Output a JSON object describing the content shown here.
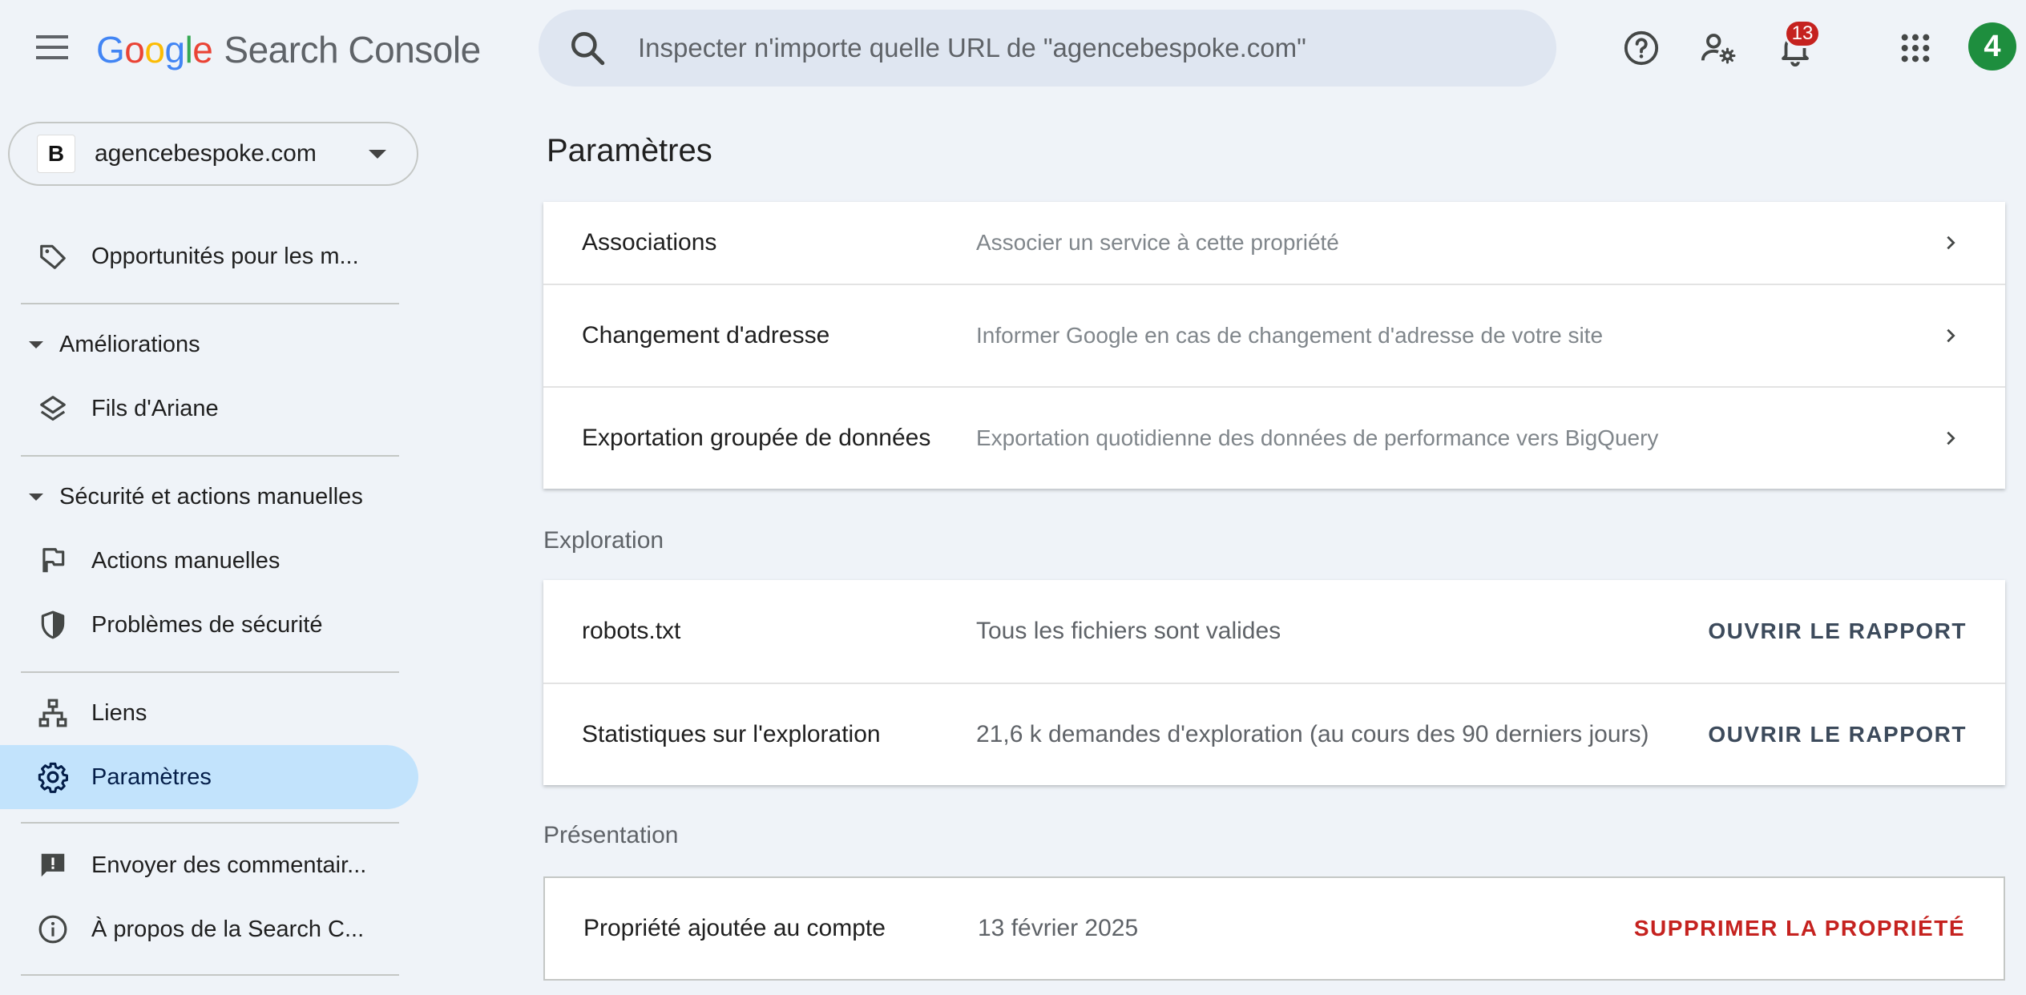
{
  "header": {
    "logo_google": [
      "G",
      "o",
      "o",
      "g",
      "l",
      "e"
    ],
    "product_name": "Search Console",
    "search_placeholder": "Inspecter n'importe quelle URL de \"agencebespoke.com\"",
    "notification_count": "13",
    "avatar_initial": "4",
    "icons": [
      "menu-icon",
      "search-icon",
      "help-icon",
      "manage-users-icon",
      "bell-icon",
      "apps-grid-icon"
    ]
  },
  "property": {
    "favicon_letter": "B",
    "name": "agencebespoke.com"
  },
  "sidebar": {
    "items_top": [
      {
        "label": "Opportunités pour les m...",
        "icon": "tag-icon"
      }
    ],
    "section_ameliorations": "Améliorations",
    "items_ameliorations": [
      {
        "label": "Fils d'Ariane",
        "icon": "layers-icon"
      }
    ],
    "section_securite": "Sécurité et actions manuelles",
    "items_securite": [
      {
        "label": "Actions manuelles",
        "icon": "flag-icon"
      },
      {
        "label": "Problèmes de sécurité",
        "icon": "shield-icon"
      }
    ],
    "items_main": [
      {
        "label": "Liens",
        "icon": "sitemap-icon"
      },
      {
        "label": "Paramètres",
        "icon": "gear-icon",
        "active": true
      }
    ],
    "items_bottom": [
      {
        "label": "Envoyer des commentair...",
        "icon": "feedback-icon"
      },
      {
        "label": "À propos de la Search C...",
        "icon": "info-icon"
      }
    ]
  },
  "main": {
    "title": "Paramètres",
    "general_rows": [
      {
        "label": "Associations",
        "desc": "Associer un service à cette propriété"
      },
      {
        "label": "Changement d'adresse",
        "desc": "Informer Google en cas de changement d'adresse de votre site"
      },
      {
        "label": "Exportation groupée de données",
        "desc": "Exportation quotidienne des données de performance vers BigQuery"
      }
    ],
    "exploration_label": "Exploration",
    "exploration_rows": [
      {
        "label": "robots.txt",
        "desc": "Tous les fichiers sont valides",
        "action": "OUVRIR LE RAPPORT"
      },
      {
        "label": "Statistiques sur l'exploration",
        "desc": "21,6 k demandes d'exploration (au cours des 90 derniers jours)",
        "action": "OUVRIR LE RAPPORT"
      }
    ],
    "presentation_label": "Présentation",
    "presentation_rows": [
      {
        "label": "Propriété ajoutée au compte",
        "desc": "13 février 2025",
        "action": "SUPPRIMER LA PROPRIÉTÉ"
      }
    ]
  },
  "colors": {
    "background": "#eff3f8",
    "active_nav": "#c2e3fc",
    "danger": "#c5221f",
    "avatar": "#1e8e3e",
    "search_bg": "#dfe6f1"
  }
}
